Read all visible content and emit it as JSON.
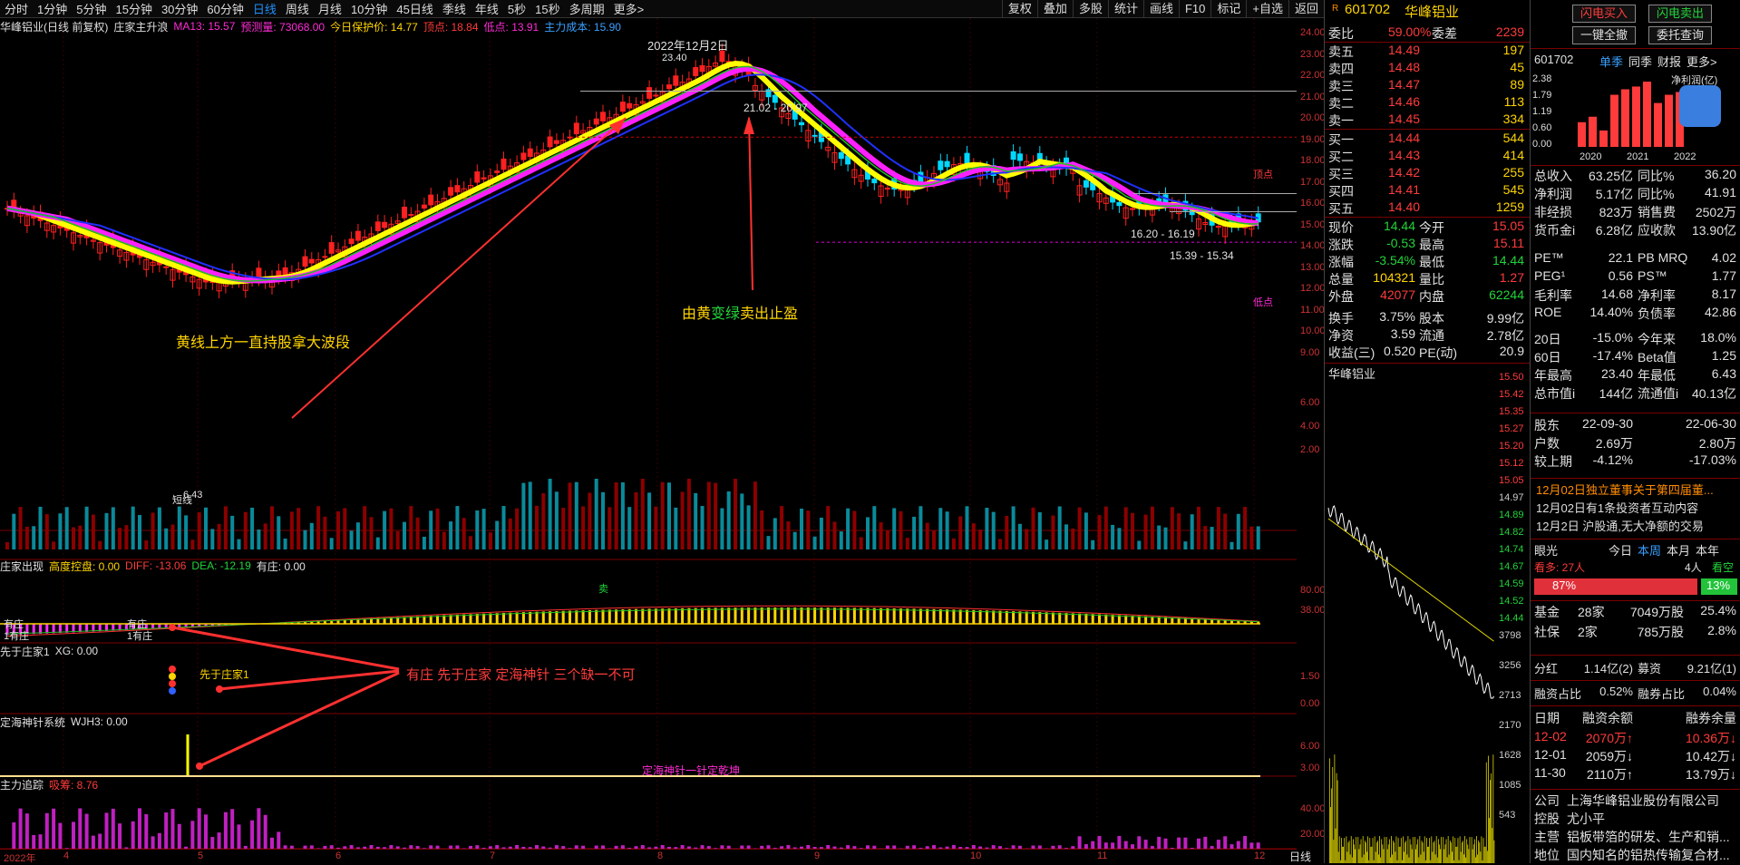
{
  "toolbar": {
    "periods": [
      "分时",
      "1分钟",
      "5分钟",
      "15分钟",
      "30分钟",
      "60分钟",
      "日线",
      "周线",
      "月线",
      "10分钟",
      "45日线",
      "季线",
      "年线",
      "5秒",
      "15秒",
      "多周期",
      "更多>"
    ],
    "active_period": "日线",
    "tools": [
      "复权",
      "叠加",
      "多股",
      "统计",
      "画线",
      "F10",
      "标记",
      "+自选",
      "返回"
    ]
  },
  "main_indicator": {
    "stock_name": "华峰铝业(日线 前复权)",
    "indicator": "庄家主升浪",
    "ma13": "MA13: 15.57",
    "yuce": "预测量: 73068.00",
    "baohu": "今日保护价: 14.77",
    "dingdian": "顶点: 18.84",
    "didian": "低点: 13.91",
    "zhuli": "主力成本: 15.90"
  },
  "price_axis": [
    "24.00",
    "23.00",
    "22.00",
    "21.00",
    "20.00",
    "19.00",
    "18.00",
    "17.00",
    "16.00",
    "15.00",
    "14.00",
    "13.00",
    "12.00",
    "11.00",
    "10.00",
    "9.00"
  ],
  "vol_axis": [
    "6.00",
    "4.00",
    "2.00"
  ],
  "chart_annotations": {
    "date_label": "2022年12月2日",
    "high": "23.40",
    "band_label": "21.02 - 20.97",
    "band2": "16.20 - 16.19",
    "band3": "15.39 - 15.34",
    "low_label": "6.43",
    "dingdian_mark": "顶点",
    "didian_mark": "低点",
    "hold_text": "黄线上方一直持股拿大波段",
    "sell_text_pre": "由黄",
    "sell_text_mid": "变绿",
    "sell_text_post": "卖出止盈",
    "three_text": "有庄 先于庄家 定海神针 三个缺一不可",
    "dingzhen_text": "定海神针一针定乾坤",
    "xian_text": "先于庄家1",
    "youzhuang_a": "有庄",
    "youzhuang_b": "1有庄",
    "youzhuang_c": "有庄",
    "youzhuang_d": "1有庄",
    "ji_mark": "卖",
    "short_mark": "短线"
  },
  "sub_panels": {
    "zhuang": {
      "title": "庄家出现",
      "a": "高度控盘: 0.00",
      "b": "DIFF: -13.06",
      "c": "DEA: -12.19",
      "d": "有庄: 0.00"
    },
    "xian": {
      "title": "先于庄家1",
      "a": "XG: 0.00"
    },
    "dinghai": {
      "title": "定海神针系统",
      "a": "WJH3: 0.00"
    },
    "zhuli": {
      "title": "主力追踪",
      "a": "吸筹: 8.76"
    }
  },
  "sub_axes": {
    "p1": [
      "80.00",
      "38.00"
    ],
    "p2": [
      "1.50",
      "0.00"
    ],
    "p3": [
      "6.00",
      "3.00"
    ],
    "p4": [
      "40.00",
      "20.00"
    ]
  },
  "date_axis": [
    "2022年",
    "4",
    "5",
    "6",
    "7",
    "8",
    "9",
    "10",
    "11",
    "12"
  ],
  "bottom_tab": "日线",
  "quote": {
    "code": "601702",
    "name": "华峰铝业",
    "weibi_label": "委比",
    "weibi": "59.00%",
    "weicha_label": "委差",
    "weicha": "2239",
    "asks": [
      {
        "label": "卖五",
        "price": "14.49",
        "vol": "197"
      },
      {
        "label": "卖四",
        "price": "14.48",
        "vol": "45"
      },
      {
        "label": "卖三",
        "price": "14.47",
        "vol": "89"
      },
      {
        "label": "卖二",
        "price": "14.46",
        "vol": "113"
      },
      {
        "label": "卖一",
        "price": "14.45",
        "vol": "334"
      }
    ],
    "bids": [
      {
        "label": "买一",
        "price": "14.44",
        "vol": "544"
      },
      {
        "label": "买二",
        "price": "14.43",
        "vol": "414"
      },
      {
        "label": "买三",
        "price": "14.42",
        "vol": "255"
      },
      {
        "label": "买四",
        "price": "14.41",
        "vol": "545"
      },
      {
        "label": "买五",
        "price": "14.40",
        "vol": "1259"
      }
    ],
    "stats": [
      {
        "l1": "现价",
        "v1": "14.44",
        "l2": "今开",
        "v2": "15.05",
        "c1": "grn",
        "c2": "red"
      },
      {
        "l1": "涨跌",
        "v1": "-0.53",
        "l2": "最高",
        "v2": "15.11",
        "c1": "grn",
        "c2": "red"
      },
      {
        "l1": "涨幅",
        "v1": "-3.54%",
        "l2": "最低",
        "v2": "14.44",
        "c1": "grn",
        "c2": "grn"
      },
      {
        "l1": "总量",
        "v1": "104321",
        "l2": "量比",
        "v2": "1.27",
        "c1": "yel",
        "c2": "red"
      },
      {
        "l1": "外盘",
        "v1": "42077",
        "l2": "内盘",
        "v2": "62244",
        "c1": "red",
        "c2": "grn"
      },
      {
        "l1": "换手",
        "v1": "3.75%",
        "l2": "股本",
        "v2": "9.99亿",
        "c1": "wht",
        "c2": "wht"
      },
      {
        "l1": "净资",
        "v1": "3.59",
        "l2": "流通",
        "v2": "2.78亿",
        "c1": "wht",
        "c2": "wht"
      },
      {
        "l1": "收益(三)",
        "v1": "0.520",
        "l2": "PE(动)",
        "v2": "20.9",
        "c1": "wht",
        "c2": "wht"
      }
    ],
    "mini_title": "华峰铝业",
    "mini_axis": [
      "15.50",
      "15.42",
      "15.35",
      "15.27",
      "15.20",
      "15.12",
      "15.05",
      "14.97",
      "14.89",
      "14.82",
      "14.74",
      "14.67",
      "14.59",
      "14.52",
      "14.44",
      "3798",
      "3256",
      "2713",
      "2170",
      "1628",
      "1085",
      "543"
    ]
  },
  "far": {
    "buy_btn": "闪电买入",
    "sell_btn": "闪电卖出",
    "cancel_btn": "一键全撤",
    "query_btn": "委托查询",
    "tabs": [
      "601702",
      "单季",
      "同季",
      "财报",
      "更多>"
    ],
    "profit_label": "净利润(亿)",
    "profit_axis": [
      "2.38",
      "1.79",
      "1.19",
      "0.60",
      "0.00"
    ],
    "years": [
      "2020",
      "2021",
      "2022"
    ],
    "profit_values": [
      0.9,
      1.1,
      0.6,
      1.9,
      2.1,
      2.2,
      2.38,
      1.6,
      1.9,
      2.0
    ],
    "fin": [
      {
        "l1": "总收入",
        "v1": "63.25亿",
        "l2": "同比%",
        "v2": "36.20"
      },
      {
        "l1": "净利润",
        "v1": "5.17亿",
        "l2": "同比%",
        "v2": "41.91"
      },
      {
        "l1": "非经损",
        "v1": "823万",
        "l2": "销售费",
        "v2": "2502万"
      },
      {
        "l1": "货币金i",
        "v1": "6.28亿",
        "l2": "应收款",
        "v2": "13.90亿"
      },
      {
        "l1": "PE™",
        "v1": "22.1",
        "l2": "PB MRQ",
        "v2": "4.02"
      },
      {
        "l1": "PEG¹",
        "v1": "0.56",
        "l2": "PS™",
        "v2": "1.77"
      },
      {
        "l1": "毛利率",
        "v1": "14.68",
        "l2": "净利率",
        "v2": "8.17"
      },
      {
        "l1": "ROE",
        "v1": "14.40%",
        "l2": "负债率",
        "v2": "42.86"
      },
      {
        "l1": "20日",
        "v1": "-15.0%",
        "l2": "今年来",
        "v2": "18.0%"
      },
      {
        "l1": "60日",
        "v1": "-17.4%",
        "l2": "Beta值",
        "v2": "1.25"
      },
      {
        "l1": "年最高",
        "v1": "23.40",
        "l2": "年最低",
        "v2": "6.43"
      },
      {
        "l1": "总市值i",
        "v1": "144亿",
        "l2": "流通值i",
        "v2": "40.13亿"
      }
    ],
    "holders": [
      {
        "l": "股东",
        "a": "22-09-30",
        "b": "22-06-30"
      },
      {
        "l": "户数",
        "a": "2.69万",
        "b": "2.80万"
      },
      {
        "l": "较上期",
        "a": "-4.12%",
        "b": "-17.03%"
      }
    ],
    "news": [
      "12月02日独立董事关于第四届董...",
      "12月02日有1条投资者互动内容",
      "12月2日 沪股通,无大净额的交易"
    ],
    "eye": {
      "label": "眼光",
      "tabs": [
        "今日",
        "本周",
        "本月",
        "本年"
      ],
      "kanduo": "看多: 27人",
      "ren": "4人",
      "kankong": "看空",
      "bull": "87%",
      "bear": "13%"
    },
    "funds": [
      {
        "l": "基金",
        "a": "28家",
        "b": "7049万股",
        "c": "25.4%"
      },
      {
        "l": "社保",
        "a": "2家",
        "b": "785万股",
        "c": "2.8%"
      }
    ],
    "fenhong": {
      "l1": "分红",
      "v1": "1.14亿(2)",
      "l2": "募资",
      "v2": "9.21亿(1)"
    },
    "rongzi": {
      "l1": "融资占比",
      "v1": "0.52%",
      "l2": "融券占比",
      "v2": "0.04%"
    },
    "margin_head": [
      "日期",
      "融资余额",
      "融券余量"
    ],
    "margin_rows": [
      {
        "d": "12-02",
        "a": "2070万↑",
        "b": "10.36万↓"
      },
      {
        "d": "12-01",
        "a": "2059万↓",
        "b": "10.42万↓"
      },
      {
        "d": "11-30",
        "a": "2110万↑",
        "b": "13.79万↓"
      }
    ],
    "company": [
      {
        "l": "公司",
        "v": "上海华峰铝业股份有限公司"
      },
      {
        "l": "控股",
        "v": "尤小平"
      },
      {
        "l": "主营",
        "v": "铝板带箔的研发、生产和销..."
      },
      {
        "l": "地位",
        "v": "国内知名的铝热传输复合材..."
      }
    ]
  }
}
